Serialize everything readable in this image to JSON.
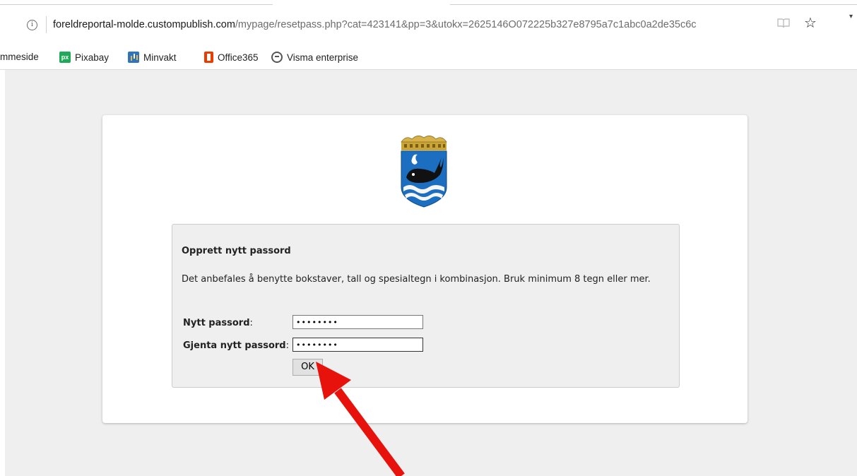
{
  "browser": {
    "url_host": "foreldreportal-molde.custompublish.com",
    "url_path": "/mypage/resetpass.php?cat=423141&pp=3&utokx=2625146O072225b327e8795a7c1abc0a2de35c6c"
  },
  "bookmarks": [
    {
      "label": "mmeside",
      "icon": "none"
    },
    {
      "label": "Pixabay",
      "icon": "pixabay-icon"
    },
    {
      "label": "Minvakt",
      "icon": "minvakt-icon"
    },
    {
      "label": "Office365",
      "icon": "office365-icon"
    },
    {
      "label": "Visma enterprise",
      "icon": "visma-icon"
    }
  ],
  "form": {
    "title": "Opprett nytt passord",
    "description": "Det anbefales å benytte bokstaver, tall og spesialtegn i kombinasjon. Bruk minimum 8 tegn eller mer.",
    "new_password_label": "Nytt passord",
    "repeat_password_label": "Gjenta nytt passord",
    "colon": ":",
    "new_password_value": "••••••••",
    "repeat_password_value": "••••••••",
    "ok_label": "OK"
  },
  "colors": {
    "arrow": "#e8120c",
    "crest_blue": "#1c6fc0",
    "crest_gold": "#c9a437"
  }
}
